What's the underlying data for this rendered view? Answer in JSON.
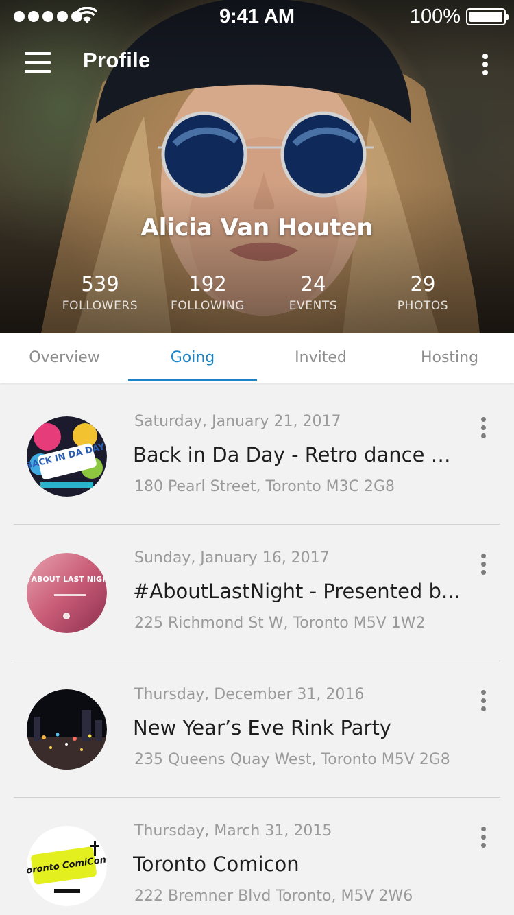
{
  "status_bar": {
    "time": "9:41 AM",
    "battery": "100%"
  },
  "header": {
    "title": "Profile"
  },
  "profile": {
    "name": "Alicia Van Houten",
    "stats": [
      {
        "value": "539",
        "label": "FOLLOWERS"
      },
      {
        "value": "192",
        "label": "FOLLOWING"
      },
      {
        "value": "24",
        "label": "EVENTS"
      },
      {
        "value": "29",
        "label": "PHOTOS"
      }
    ]
  },
  "tabs": [
    {
      "label": "Overview",
      "active": false
    },
    {
      "label": "Going",
      "active": true
    },
    {
      "label": "Invited",
      "active": false
    },
    {
      "label": "Hosting",
      "active": false
    }
  ],
  "events": [
    {
      "date": "Saturday, January 21, 2017",
      "title": "Back in Da Day - Retro dance p...",
      "address": "180 Pearl Street, Toronto M3C 2G8",
      "thumb_text": "BACK IN DA DAY"
    },
    {
      "date": "Sunday, January 16, 2017",
      "title": "#AboutLastNight - Presented b...",
      "address": "225 Richmond St W, Toronto M5V 1W2",
      "thumb_text": "#ABOUT LAST NIGHT"
    },
    {
      "date": "Thursday, December 31, 2016",
      "title": "New Year’s Eve Rink Party",
      "address": "235 Queens Quay West, Toronto M5V 2G8"
    },
    {
      "date": "Thursday, March 31, 2015",
      "title": "Toronto Comicon",
      "address": "222 Bremner Blvd Toronto, M5V 2W6",
      "thumb_text": "Toronto ComiCon"
    }
  ],
  "colors": {
    "accent": "#1b84c9",
    "list_background": "#f2f2f2",
    "muted_text": "#9a9a9a"
  },
  "icons": {
    "menu": "hamburger-icon",
    "more": "more-vert-icon",
    "wifi": "wifi-icon",
    "battery": "battery-icon"
  }
}
